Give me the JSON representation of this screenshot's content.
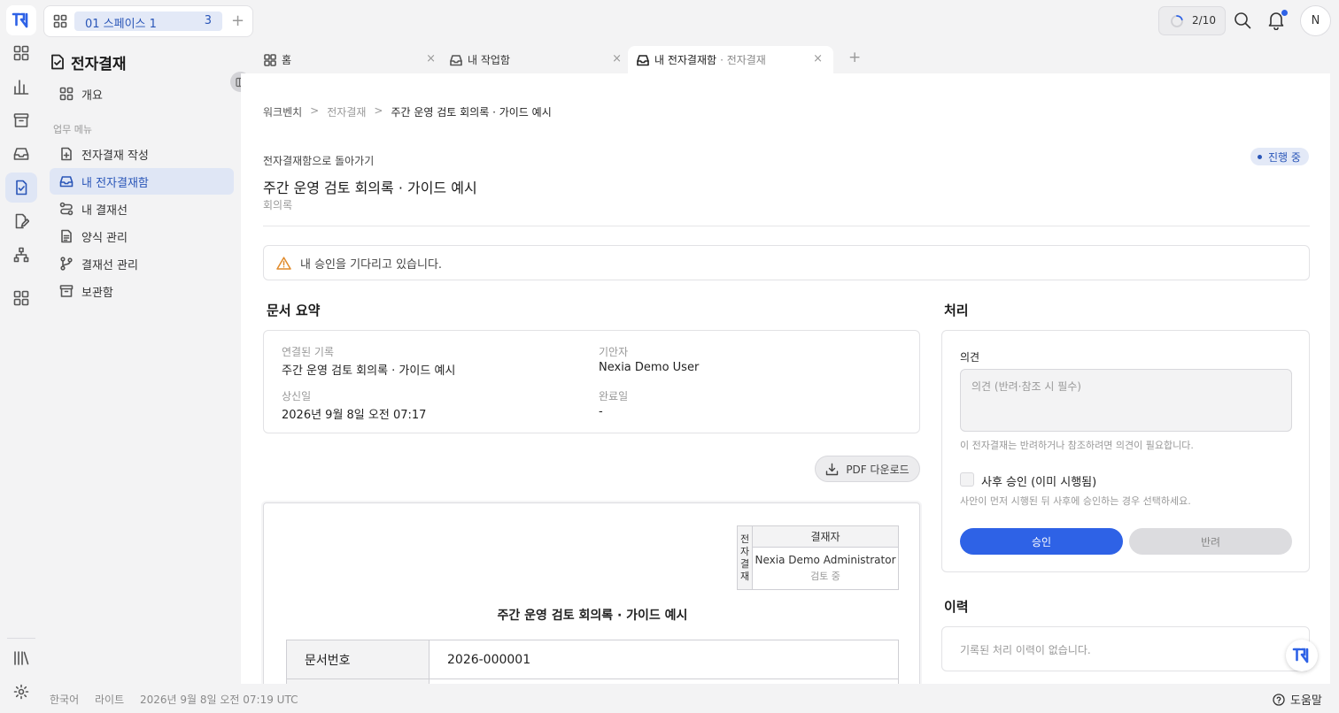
{
  "brand": {
    "logo_color": "#2e62e6"
  },
  "space": {
    "name": "01 스페이스 1",
    "count": "3"
  },
  "topbar": {
    "progress": "2/10",
    "progress_fraction": 0.2,
    "avatar_initial": "N"
  },
  "rail": [
    {
      "icon": "grid-icon"
    },
    {
      "icon": "bar-chart-icon"
    },
    {
      "icon": "archive-icon"
    },
    {
      "icon": "inbox-icon"
    },
    {
      "icon": "doc-check-icon",
      "active": true
    },
    {
      "icon": "doc-edit-icon"
    },
    {
      "icon": "org-chart-icon"
    },
    {
      "icon": "apps-icon"
    },
    {
      "icon": "library-icon"
    },
    {
      "icon": "settings-icon"
    }
  ],
  "sidebar": {
    "title": "전자결재",
    "overview": "개요",
    "section": "업무 메뉴",
    "items": [
      {
        "label": "전자결재 작성",
        "icon": "doc-plus-icon"
      },
      {
        "label": "내 전자결재함",
        "icon": "inbox-icon",
        "active": true
      },
      {
        "label": "내 결재선",
        "icon": "route-icon"
      },
      {
        "label": "양식 관리",
        "icon": "form-icon"
      },
      {
        "label": "결재선 관리",
        "icon": "branch-icon"
      },
      {
        "label": "보관함",
        "icon": "archive-icon"
      }
    ]
  },
  "tabs": [
    {
      "label": "홈",
      "sub": "",
      "icon": "grid-icon"
    },
    {
      "label": "내 작업함",
      "sub": "",
      "icon": "inbox-icon"
    },
    {
      "label": "내 전자결재함",
      "sub": "· 전자결재",
      "icon": "inbox-icon",
      "active": true
    }
  ],
  "breadcrumb": {
    "root": "워크벤치",
    "mid": "전자결재",
    "current": "주간 운영 검토 회의록 · 가이드 예시"
  },
  "doc": {
    "back": "전자결재함으로 돌아가기",
    "status": "진행 중",
    "title": "주간 운영 검토 회의록 · 가이드 예시",
    "type": "회의록",
    "alert": "내 승인을 기다리고 있습니다."
  },
  "summary": {
    "heading": "문서 요약",
    "linked_label": "연결된 기록",
    "linked_value": "주간 운영 검토 회의록 · 가이드 예시",
    "drafter_label": "기안자",
    "drafter_value": "Nexia Demo User",
    "submitted_label": "상신일",
    "submitted_value": "2026년 9월 8일 오전 07:17",
    "completed_label": "완료일",
    "completed_value": "-"
  },
  "pdf_button": "PDF 다운로드",
  "paper": {
    "side_label": "전자결재",
    "approver_header": "결재자",
    "approver_name": "Nexia Demo Administrator",
    "approver_state": "검토 중",
    "title": "주간 운영 검토 회의록 · 가이드 예시",
    "doc_no_label": "문서번호",
    "doc_no_value": "2026-000001"
  },
  "process": {
    "heading": "처리",
    "opinion_label": "의견",
    "opinion_placeholder": "의견 (반려·참조 시 필수)",
    "opinion_hint": "이 전자결재는 반려하거나 참조하려면 의견이 필요합니다.",
    "post_approval_label": "사후 승인 (이미 시행됨)",
    "post_approval_hint": "사안이 먼저 시행된 뒤 사후에 승인하는 경우 선택하세요.",
    "approve": "승인",
    "reject": "반려"
  },
  "history": {
    "heading": "이력",
    "empty": "기록된 처리 이력이 없습니다."
  },
  "footer": {
    "language": "한국어",
    "theme": "라이트",
    "time": "2026년 9월 8일 오전 07:19 UTC",
    "help": "도움말"
  }
}
